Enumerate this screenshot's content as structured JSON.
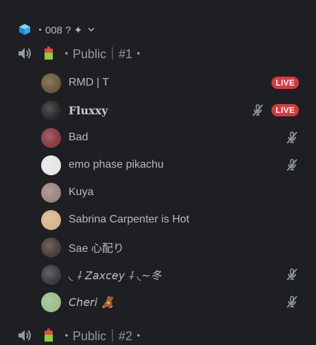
{
  "category": {
    "name": "・008 ? ✦",
    "icon": "ice-cube-icon"
  },
  "channels": [
    {
      "label": "・Public｜#1・",
      "icon": "speaker-icon",
      "emoji": "battery-icon"
    },
    {
      "label": "・Public｜#2・",
      "icon": "speaker-icon",
      "emoji": "battery-icon"
    }
  ],
  "users": [
    {
      "name": "RMD | T",
      "live": "LIVE",
      "muted": false,
      "avatar_color": "#6b5a3e"
    },
    {
      "name": "Fluxxy",
      "live": "LIVE",
      "muted": true,
      "avatar_color": "#2a2a2a"
    },
    {
      "name": "Bad",
      "live": "",
      "muted": true,
      "avatar_color": "#8a3a44"
    },
    {
      "name": "emo phase pikachu",
      "live": "",
      "muted": true,
      "avatar_color": "#e6e6e6"
    },
    {
      "name": "Kuya",
      "live": "",
      "muted": false,
      "avatar_color": "#9c8680"
    },
    {
      "name": "Sabrina Carpenter is Hot",
      "live": "",
      "muted": false,
      "avatar_color": "#d7b48a"
    },
    {
      "name": "Sae 心配り",
      "live": "",
      "muted": false,
      "avatar_color": "#4a3e3a"
    },
    {
      "name": "◟ ⸸ 𝘡𝘢𝘹𝘤𝘦𝘺 ⸸ ◟~冬",
      "live": "",
      "muted": true,
      "avatar_color": "#3c3c46"
    },
    {
      "name": "𝘊𝘩𝘦𝘳𝘪 🧸",
      "live": "",
      "muted": true,
      "avatar_color": "#9bbf8a"
    }
  ]
}
